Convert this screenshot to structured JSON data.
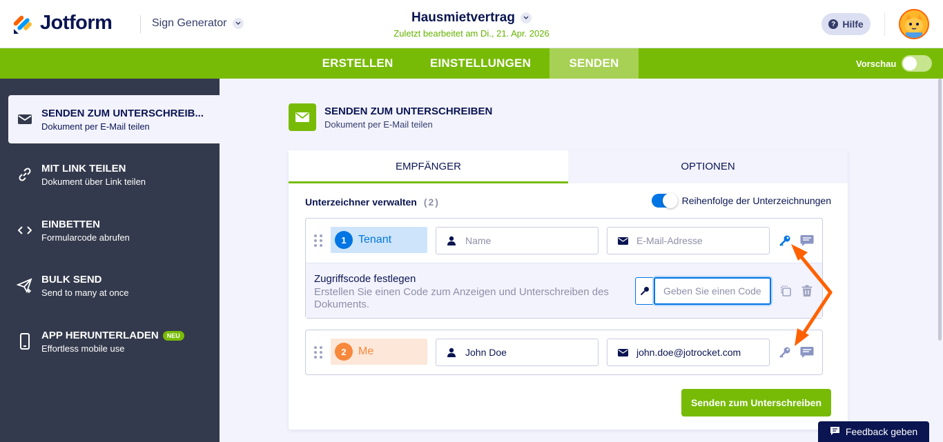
{
  "header": {
    "logo_text": "Jotform",
    "app_switcher": "Sign Generator",
    "doc_title": "Hausmietvertrag",
    "last_edited": "Zuletzt bearbeitet am Di., 21. Apr. 2026",
    "help_label": "Hilfe"
  },
  "nav": {
    "tabs": [
      {
        "label": "ERSTELLEN",
        "active": false
      },
      {
        "label": "EINSTELLUNGEN",
        "active": false
      },
      {
        "label": "SENDEN",
        "active": true
      }
    ],
    "preview_label": "Vorschau",
    "preview_on": false
  },
  "sidebar": {
    "items": [
      {
        "title": "SENDEN ZUM UNTERSCHREIB...",
        "subtitle": "Dokument per E-Mail teilen",
        "icon": "envelope-icon",
        "active": true
      },
      {
        "title": "MIT LINK TEILEN",
        "subtitle": "Dokument über Link teilen",
        "icon": "link-icon",
        "active": false
      },
      {
        "title": "EINBETTEN",
        "subtitle": "Formularcode abrufen",
        "icon": "code-icon",
        "active": false
      },
      {
        "title": "BULK SEND",
        "subtitle": "Send to many at once",
        "icon": "paper-plane-icon",
        "active": false
      },
      {
        "title": "APP HERUNTERLADEN",
        "subtitle": "Effortless mobile use",
        "icon": "phone-icon",
        "active": false,
        "badge": "NEU"
      }
    ]
  },
  "main": {
    "title": "SENDEN ZUM UNTERSCHREIBEN",
    "subtitle": "Dokument per E-Mail teilen",
    "tabs": [
      {
        "label": "EMPFÄNGER",
        "active": true
      },
      {
        "label": "OPTIONEN",
        "active": false
      }
    ],
    "signers_label": "Unterzeichner verwalten",
    "signers_count": "(2)",
    "order_label": "Reihenfolge der Unterzeichnungen",
    "order_on": true,
    "signers": [
      {
        "number": "1",
        "role": "Tenant",
        "name_placeholder": "Name",
        "name_value": "",
        "email_placeholder": "E-Mail-Adresse",
        "email_value": "",
        "role_color": "#0075e3",
        "role_bg": "#cde4fb"
      },
      {
        "number": "2",
        "role": "Me",
        "name_placeholder": "Name",
        "name_value": "John Doe",
        "email_placeholder": "E-Mail-Adresse",
        "email_value": "john.doe@jotrocket.com",
        "role_color": "#f7883c",
        "role_bg": "#fde7d8"
      }
    ],
    "access_code": {
      "title": "Zugriffscode festlegen",
      "description": "Erstellen Sie einen Code zum Anzeigen und Unterschreiben des Dokuments.",
      "placeholder": "Geben Sie einen Code"
    },
    "send_button": "Senden zum Unterschreiben"
  },
  "feedback_label": "Feedback geben",
  "colors": {
    "brand_green": "#78bb07",
    "navy": "#0a1551",
    "blue": "#0075e3",
    "sidebar": "#343a4d",
    "annotation_orange": "#ff6100"
  }
}
